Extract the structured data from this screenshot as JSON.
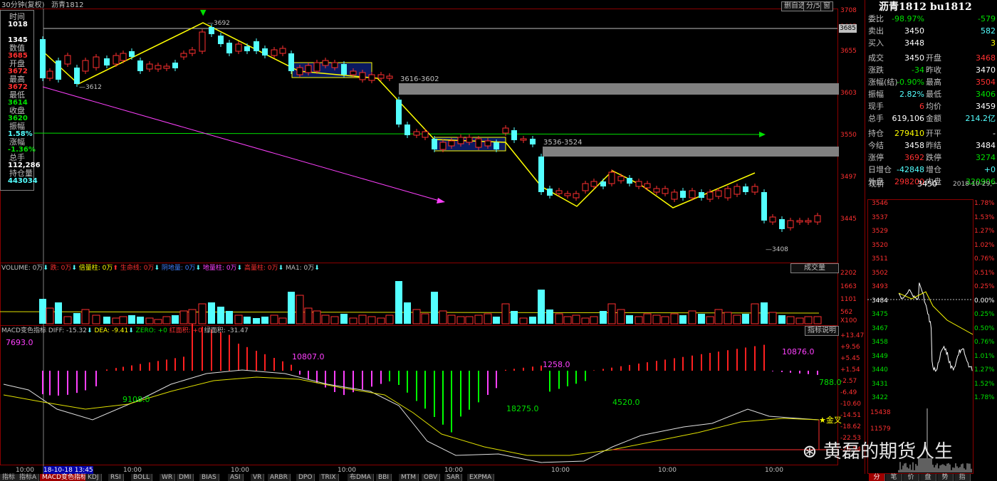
{
  "header": {
    "title": "30分钟(复权)",
    "symbol": "沥青1812",
    "btn_auto": "删自选",
    "btn_unit": "分/5",
    "btn_more": "窗"
  },
  "left_info": [
    {
      "k": "时间",
      "v": "1018",
      "c": "white"
    },
    {
      "k": "",
      "v": "1345",
      "c": "white"
    },
    {
      "k": "数值",
      "v": "3685",
      "c": "red"
    },
    {
      "k": "开盘",
      "v": "3672",
      "c": "red"
    },
    {
      "k": "最高",
      "v": "3672",
      "c": "red"
    },
    {
      "k": "最低",
      "v": "3614",
      "c": "green"
    },
    {
      "k": "收盘",
      "v": "3620",
      "c": "green"
    },
    {
      "k": "振幅",
      "v": "1.58%",
      "c": "cyan"
    },
    {
      "k": "涨幅",
      "v": "-1.36%",
      "c": "green"
    },
    {
      "k": "总手",
      "v": "112,286",
      "c": "white"
    },
    {
      "k": "持仓量",
      "v": "443034",
      "c": "cyan"
    }
  ],
  "price_axis": [
    "3708",
    "3685",
    "3655",
    "3603",
    "3550",
    "3497",
    "3445"
  ],
  "annotations": {
    "high": "3692",
    "low1": "3612",
    "low2": "3408",
    "gap1": "3616-3602",
    "gap2": "3536-3524"
  },
  "volume_header": {
    "vol": "VOLUME: 0万",
    "dl": "跌: 0万",
    "bl": "倍量柱: 0万",
    "sm": "生命线: 0万",
    "dl2": "阴地量: 0万",
    "dil": "地量柱: 0万",
    "gl": "高量柱: 0万",
    "ma1": "MA1: 0万",
    "btn": "成交量"
  },
  "volume_axis": [
    "2202",
    "1663",
    "1101",
    "562",
    "X100"
  ],
  "macd_header": {
    "title": "MACD变色指标",
    "diff": "DIFF: -15.32",
    "dea": "DEA: -9.41",
    "zero": "ZERO: +0",
    "hong": "红面积: +0",
    "lv": "绿面积: -31.47",
    "btn": "指标说明"
  },
  "macd_axis": [
    "+13.47",
    "+9.56",
    "+5.45",
    "+1.54",
    "-2.57",
    "-6.49",
    "-10.60",
    "-14.51",
    "-18.62",
    "-22.53",
    "-26.54"
  ],
  "macd_labels": [
    "7693.0",
    "10807.0",
    "1258.0",
    "10876.0",
    "9108.0",
    "18275.0",
    "4520.0",
    "788.0"
  ],
  "gold_cross": "★金叉",
  "time_axis": [
    "10:00",
    "18-10-18 13:45",
    "10:00",
    "10:00",
    "10:00",
    "10:00",
    "10:00",
    "10:00",
    "10:00"
  ],
  "tabs": [
    "指标",
    "指标A",
    "MACD变色指标",
    "KDJ",
    "RSI",
    "BOLL",
    "WR",
    "DMI",
    "BIAS",
    "ASI",
    "VR",
    "ARBR",
    "DPO",
    "TRIX",
    "布DMA",
    "BBI",
    "MTM",
    "OBV",
    "SAR",
    "EXPMA"
  ],
  "right_panel": {
    "title": "沥青1812 bu1812",
    "rows": [
      {
        "a": "委比",
        "av": "-98.97%",
        "ac": "green",
        "b": "",
        "bv": "-579",
        "bc": "green"
      },
      {
        "a": "卖出",
        "av": "3450",
        "ac": "white",
        "b": "",
        "bv": "582",
        "bc": "cyan"
      },
      {
        "a": "买入",
        "av": "3448",
        "ac": "white",
        "b": "",
        "bv": "3",
        "bc": "yellow"
      },
      {
        "a": "成交",
        "av": "3450",
        "ac": "white",
        "b": "开盘",
        "bv": "3468",
        "bc": "red"
      },
      {
        "a": "涨跌",
        "av": "-34",
        "ac": "green",
        "b": "昨收",
        "bv": "3470",
        "bc": "white"
      },
      {
        "a": "涨幅(结)",
        "av": "-0.90%",
        "ac": "green",
        "b": "最高",
        "bv": "3504",
        "bc": "red"
      },
      {
        "a": "振幅",
        "av": "2.82%",
        "ac": "cyan",
        "b": "最低",
        "bv": "3406",
        "bc": "green"
      },
      {
        "a": "现手",
        "av": "6",
        "ac": "red",
        "b": "均价",
        "bv": "3459",
        "bc": "white"
      },
      {
        "a": "总手",
        "av": "619,106",
        "ac": "white",
        "b": "金额",
        "bv": "214.2亿",
        "bc": "cyan"
      },
      {
        "a": "持仓",
        "av": "279410",
        "ac": "yellow",
        "b": "开平",
        "bv": "-",
        "bc": "white"
      },
      {
        "a": "今结",
        "av": "3458",
        "ac": "white",
        "b": "昨结",
        "bv": "3484",
        "bc": "white"
      },
      {
        "a": "涨停",
        "av": "3692",
        "ac": "red",
        "b": "跌停",
        "bv": "3274",
        "bc": "green"
      },
      {
        "a": "日增仓",
        "av": "-42848",
        "ac": "cyan",
        "b": "增仓",
        "bv": "+0",
        "bc": "cyan"
      },
      {
        "a": "外盘",
        "av": "298200",
        "ac": "red",
        "b": "内盘",
        "bv": "320906",
        "bc": "green"
      }
    ],
    "now_label": "现价",
    "now_value": "3450",
    "date": "2018-10-29,一",
    "mini_left": [
      "3546",
      "3537",
      "3529",
      "3520",
      "3511",
      "3502",
      "3493",
      "3484",
      "3475",
      "3467",
      "3458",
      "3449",
      "3440",
      "3431",
      "3422"
    ],
    "mini_right": [
      "1.78%",
      "1.53%",
      "1.27%",
      "1.02%",
      "0.76%",
      "0.51%",
      "0.25%",
      "0.00%",
      "0.25%",
      "0.50%",
      "0.76%",
      "1.01%",
      "1.27%",
      "1.52%",
      "1.78%"
    ],
    "mini_vol": [
      "15438",
      "11579"
    ],
    "bottom_tabs": [
      "分",
      "笔",
      "价",
      "盘",
      "势",
      "指"
    ],
    "watermark": "黄磊的期货人生"
  }
}
